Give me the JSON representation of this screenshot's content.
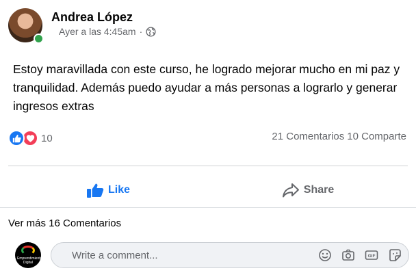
{
  "post": {
    "author": "Andrea López",
    "time": "Ayer a las 4:45am",
    "separator": "·",
    "text": "Estoy maravillada con este curso, he logrado mejorar mucho en mi paz y tranquilidad. Además puedo ayudar a más personas a lograrlo y generar ingresos extras",
    "online": true
  },
  "reactions": {
    "types": [
      "like-icon",
      "love-icon"
    ],
    "count": "10",
    "comments": "21 Comentarios",
    "shares": "10 Comparte"
  },
  "actions": {
    "like_label": "Like",
    "share_label": "Share"
  },
  "comments": {
    "more_label": "Ver más 16 Comentarios",
    "input_placeholder": "Write a comment...",
    "commenter_avatar_text": "Emprendimiento Digital"
  },
  "colors": {
    "accent": "#1877f2",
    "love": "#f33e58",
    "online": "#31a24c",
    "muted": "#65676b"
  }
}
